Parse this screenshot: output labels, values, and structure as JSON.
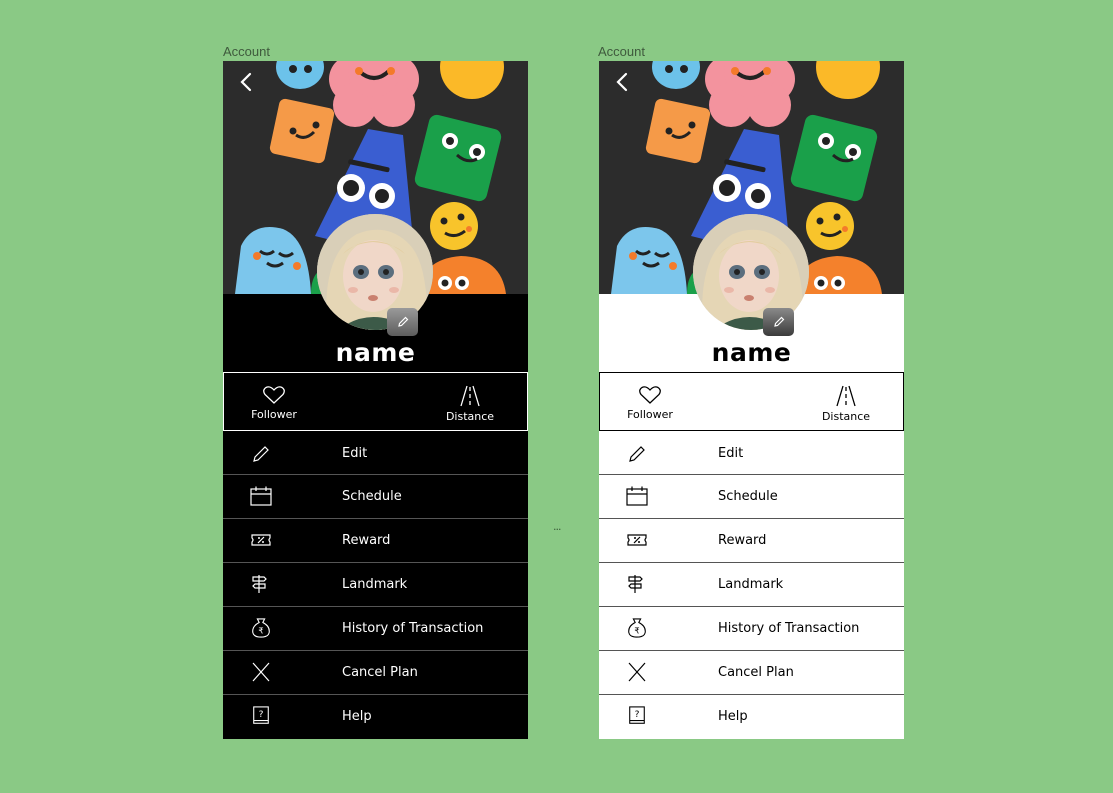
{
  "frames": [
    {
      "id": "dark",
      "label": "Account"
    },
    {
      "id": "light",
      "label": "Account"
    }
  ],
  "profile": {
    "name": "name"
  },
  "stats": {
    "follower_label": "Follower",
    "distance_label": "Distance"
  },
  "menu": [
    {
      "label": "Edit",
      "icon": "pencil-icon"
    },
    {
      "label": "Schedule",
      "icon": "calendar-icon"
    },
    {
      "label": "Reward",
      "icon": "ticket-icon"
    },
    {
      "label": "Landmark",
      "icon": "signpost-icon"
    },
    {
      "label": "History of Transaction",
      "icon": "money-bag-icon"
    },
    {
      "label": "Cancel Plan",
      "icon": "close-icon"
    },
    {
      "label": "Help",
      "icon": "help-book-icon"
    }
  ],
  "between_frames": "...",
  "colors": {
    "canvas": "#8ac985",
    "banner_bg": "#2c2c2c",
    "dark_bg": "#000000",
    "light_bg": "#ffffff"
  }
}
